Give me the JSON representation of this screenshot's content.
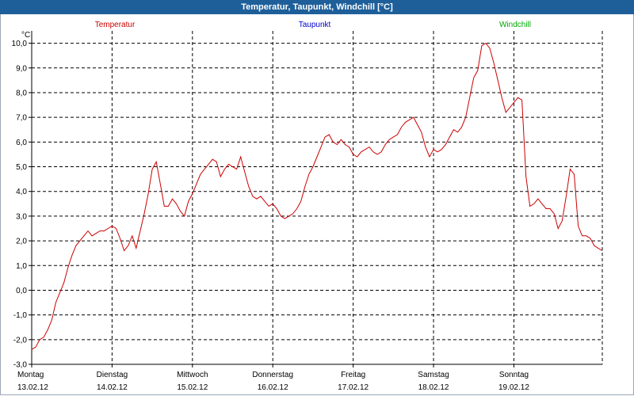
{
  "window": {
    "title": "Temperatur, Taupunkt, Windchill [°C]"
  },
  "chart_data": {
    "type": "line",
    "unit_label": "°C",
    "title": "Temperatur, Taupunkt, Windchill [°C]",
    "ylim": [
      -3.0,
      10.5
    ],
    "yticks": [
      "10,0",
      "9,0",
      "8,0",
      "7,0",
      "6,0",
      "5,0",
      "4,0",
      "3,0",
      "2,0",
      "1,0",
      "0,0",
      "-1,0",
      "-2,0",
      "-3,0"
    ],
    "ytick_values": [
      10,
      9,
      8,
      7,
      6,
      5,
      4,
      3,
      2,
      1,
      0,
      -1,
      -2,
      -3
    ],
    "xlim": [
      0,
      7.1
    ],
    "days": [
      {
        "weekday": "Montag",
        "date": "13.02.12"
      },
      {
        "weekday": "Dienstag",
        "date": "14.02.12"
      },
      {
        "weekday": "Mittwoch",
        "date": "15.02.12"
      },
      {
        "weekday": "Donnerstag",
        "date": "16.02.12"
      },
      {
        "weekday": "Freitag",
        "date": "17.02.12"
      },
      {
        "weekday": "Samstag",
        "date": "18.02.12"
      },
      {
        "weekday": "Sonntag",
        "date": "19.02.12"
      }
    ],
    "grid": true,
    "legend": [
      {
        "name": "Temperatur",
        "color": "#cc0000"
      },
      {
        "name": "Taupunkt",
        "color": "#0000cc"
      },
      {
        "name": "Windchill",
        "color": "#00aa00"
      }
    ],
    "series": [
      {
        "name": "Temperatur",
        "color": "#cc0000",
        "x": [
          0.0,
          0.05,
          0.1,
          0.15,
          0.2,
          0.25,
          0.3,
          0.35,
          0.4,
          0.45,
          0.5,
          0.55,
          0.6,
          0.65,
          0.7,
          0.75,
          0.8,
          0.85,
          0.9,
          0.95,
          1.0,
          1.05,
          1.1,
          1.15,
          1.2,
          1.25,
          1.3,
          1.35,
          1.4,
          1.45,
          1.5,
          1.55,
          1.6,
          1.65,
          1.7,
          1.75,
          1.8,
          1.85,
          1.9,
          1.95,
          2.0,
          2.05,
          2.1,
          2.15,
          2.2,
          2.25,
          2.3,
          2.35,
          2.4,
          2.45,
          2.5,
          2.55,
          2.6,
          2.65,
          2.7,
          2.75,
          2.8,
          2.85,
          2.9,
          2.95,
          3.0,
          3.05,
          3.1,
          3.15,
          3.2,
          3.25,
          3.3,
          3.35,
          3.4,
          3.45,
          3.5,
          3.55,
          3.6,
          3.65,
          3.7,
          3.75,
          3.8,
          3.85,
          3.9,
          3.95,
          4.0,
          4.05,
          4.1,
          4.15,
          4.2,
          4.25,
          4.3,
          4.35,
          4.4,
          4.45,
          4.5,
          4.55,
          4.6,
          4.65,
          4.7,
          4.75,
          4.8,
          4.85,
          4.9,
          4.95,
          5.0,
          5.05,
          5.1,
          5.15,
          5.2,
          5.25,
          5.3,
          5.35,
          5.4,
          5.45,
          5.5,
          5.55,
          5.6,
          5.65,
          5.7,
          5.75,
          5.8,
          5.85,
          5.9,
          5.95,
          6.0,
          6.05,
          6.1,
          6.15,
          6.2,
          6.25,
          6.3,
          6.35,
          6.4,
          6.45,
          6.5,
          6.55,
          6.6,
          6.65,
          6.7,
          6.75,
          6.8,
          6.85,
          6.9,
          6.95,
          7.0,
          7.05,
          7.1
        ],
        "values": [
          -2.4,
          -2.3,
          -2.0,
          -1.9,
          -1.6,
          -1.2,
          -0.5,
          -0.1,
          0.3,
          0.9,
          1.4,
          1.8,
          2.0,
          2.2,
          2.4,
          2.2,
          2.3,
          2.4,
          2.4,
          2.5,
          2.6,
          2.5,
          2.1,
          1.6,
          1.8,
          2.2,
          1.7,
          2.4,
          3.1,
          3.9,
          4.9,
          5.2,
          4.3,
          3.4,
          3.4,
          3.7,
          3.5,
          3.2,
          3.0,
          3.6,
          3.9,
          4.3,
          4.7,
          4.9,
          5.1,
          5.3,
          5.2,
          4.6,
          4.9,
          5.1,
          5.0,
          4.9,
          5.4,
          4.8,
          4.2,
          3.8,
          3.7,
          3.8,
          3.6,
          3.4,
          3.5,
          3.3,
          3.0,
          2.9,
          3.0,
          3.1,
          3.3,
          3.6,
          4.2,
          4.7,
          5.0,
          5.4,
          5.8,
          6.2,
          6.3,
          6.0,
          5.9,
          6.1,
          5.9,
          5.8,
          5.5,
          5.4,
          5.6,
          5.7,
          5.8,
          5.6,
          5.5,
          5.6,
          5.9,
          6.1,
          6.2,
          6.3,
          6.6,
          6.8,
          6.9,
          7.0,
          6.7,
          6.4,
          5.8,
          5.4,
          5.7,
          5.6,
          5.7,
          5.9,
          6.2,
          6.5,
          6.4,
          6.6,
          7.0,
          7.8,
          8.6,
          8.9,
          9.9,
          10.0,
          9.8,
          9.2,
          8.5,
          7.8,
          7.2,
          7.4,
          7.6,
          7.8,
          7.7,
          4.6,
          3.4,
          3.5,
          3.7,
          3.5,
          3.3,
          3.3,
          3.1,
          2.5,
          2.8,
          3.8,
          4.9,
          4.7,
          2.6,
          2.2,
          2.2,
          2.1,
          1.8,
          1.7,
          1.6
        ]
      },
      {
        "name": "Taupunkt",
        "color": "#0000cc",
        "x": [],
        "values": []
      },
      {
        "name": "Windchill",
        "color": "#00aa00",
        "x": [],
        "values": []
      }
    ]
  }
}
